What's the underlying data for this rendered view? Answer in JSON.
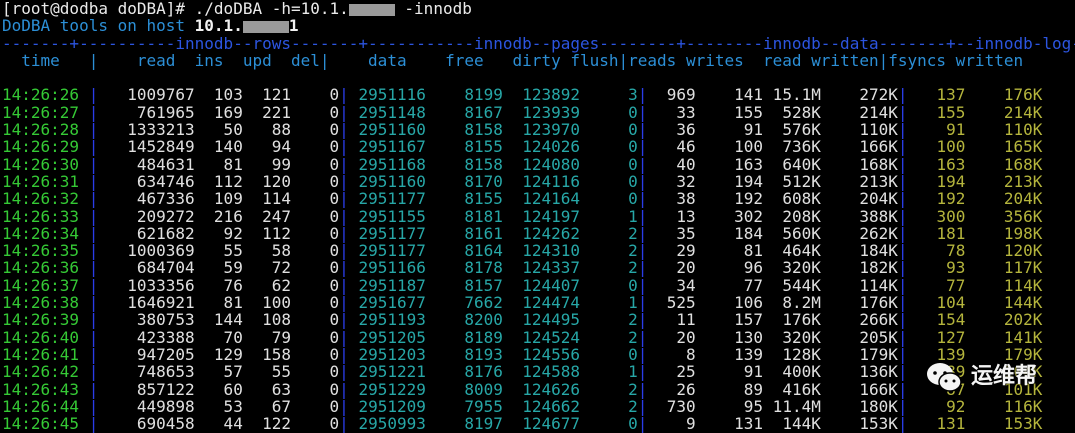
{
  "terminal": {
    "prompt": "[root@dodba doDBA]# ./doDBA -h=10.1.",
    "prompt_suffix": " -innodb",
    "banner": "DoDBA tools on host ",
    "host": "10.1.",
    "host_tail": "1",
    "group_line": "-------+----------innodb--rows-------+-----------innodb--pages--------+--------innodb--data-------+--innodb-log--",
    "header": {
      "time": "  time   |",
      "rows": "    read  ins  upd  del|",
      "pages": "    data    free   dirty flush|",
      "data": "reads writes  read written|",
      "log": "fsyncs written"
    },
    "columns": [
      "time",
      "read",
      "ins",
      "upd",
      "del",
      "data",
      "free",
      "dirty",
      "flush",
      "reads",
      "writes",
      "read",
      "written",
      "fsyncs",
      "written"
    ],
    "rows": [
      [
        "14:26:26",
        "1009767",
        "103",
        "121",
        "0",
        "2951116",
        "8199",
        "123892",
        "3",
        "969",
        "141",
        "15.1M",
        "272K",
        "137",
        "176K"
      ],
      [
        "14:26:27",
        "761965",
        "169",
        "221",
        "0",
        "2951148",
        "8167",
        "123939",
        "0",
        "33",
        "155",
        "528K",
        "214K",
        "155",
        "214K"
      ],
      [
        "14:26:28",
        "1333213",
        "50",
        "88",
        "0",
        "2951160",
        "8158",
        "123970",
        "0",
        "36",
        "91",
        "576K",
        "110K",
        "91",
        "110K"
      ],
      [
        "14:26:29",
        "1452849",
        "140",
        "94",
        "0",
        "2951167",
        "8155",
        "124026",
        "0",
        "46",
        "100",
        "736K",
        "166K",
        "100",
        "165K"
      ],
      [
        "14:26:30",
        "484631",
        "81",
        "99",
        "0",
        "2951168",
        "8158",
        "124080",
        "0",
        "40",
        "163",
        "640K",
        "168K",
        "163",
        "168K"
      ],
      [
        "14:26:31",
        "634746",
        "112",
        "120",
        "0",
        "2951160",
        "8170",
        "124116",
        "0",
        "32",
        "194",
        "512K",
        "213K",
        "194",
        "213K"
      ],
      [
        "14:26:32",
        "467336",
        "109",
        "114",
        "0",
        "2951177",
        "8155",
        "124164",
        "0",
        "38",
        "192",
        "608K",
        "204K",
        "192",
        "204K"
      ],
      [
        "14:26:33",
        "209272",
        "216",
        "247",
        "0",
        "2951155",
        "8181",
        "124197",
        "1",
        "13",
        "302",
        "208K",
        "388K",
        "300",
        "356K"
      ],
      [
        "14:26:34",
        "621682",
        "92",
        "112",
        "0",
        "2951177",
        "8161",
        "124262",
        "2",
        "35",
        "184",
        "560K",
        "262K",
        "181",
        "198K"
      ],
      [
        "14:26:35",
        "1000369",
        "55",
        "58",
        "0",
        "2951177",
        "8164",
        "124310",
        "2",
        "29",
        "81",
        "464K",
        "184K",
        "78",
        "120K"
      ],
      [
        "14:26:36",
        "684704",
        "59",
        "72",
        "0",
        "2951166",
        "8178",
        "124337",
        "2",
        "20",
        "96",
        "320K",
        "182K",
        "93",
        "117K"
      ],
      [
        "14:26:37",
        "1033356",
        "76",
        "62",
        "0",
        "2951187",
        "8157",
        "124407",
        "0",
        "34",
        "77",
        "544K",
        "114K",
        "77",
        "114K"
      ],
      [
        "14:26:38",
        "1646921",
        "81",
        "100",
        "0",
        "2951677",
        "7662",
        "124474",
        "1",
        "525",
        "106",
        "8.2M",
        "176K",
        "104",
        "144K"
      ],
      [
        "14:26:39",
        "380753",
        "144",
        "108",
        "0",
        "2951193",
        "8200",
        "124495",
        "2",
        "11",
        "157",
        "176K",
        "266K",
        "154",
        "202K"
      ],
      [
        "14:26:40",
        "423388",
        "70",
        "79",
        "0",
        "2951205",
        "8189",
        "124524",
        "2",
        "20",
        "130",
        "320K",
        "205K",
        "127",
        "141K"
      ],
      [
        "14:26:41",
        "947205",
        "129",
        "158",
        "0",
        "2951203",
        "8193",
        "124556",
        "0",
        "8",
        "139",
        "128K",
        "179K",
        "139",
        "179K"
      ],
      [
        "14:26:42",
        "748653",
        "57",
        "55",
        "0",
        "2951221",
        "8176",
        "124588",
        "1",
        "25",
        "91",
        "400K",
        "136K",
        "89",
        "104K"
      ],
      [
        "14:26:43",
        "857122",
        "60",
        "63",
        "0",
        "2951229",
        "8009",
        "124626",
        "2",
        "26",
        "89",
        "416K",
        "166K",
        "87",
        "101K"
      ],
      [
        "14:26:44",
        "449898",
        "53",
        "67",
        "0",
        "2951209",
        "7955",
        "124662",
        "2",
        "730",
        "95",
        "11.4M",
        "180K",
        "92",
        "116K"
      ],
      [
        "14:26:45",
        "690458",
        "44",
        "122",
        "0",
        "2950993",
        "8197",
        "124677",
        "0",
        "9",
        "131",
        "144K",
        "153K",
        "131",
        "153K"
      ]
    ]
  },
  "watermark": {
    "text": "运维帮",
    "icon": "wechat-icon"
  },
  "colors": {
    "time": "#35c935",
    "rows": "#e0e0e0",
    "pages": "#27a7a7",
    "data": "#e0e0e0",
    "log": "#b5b53d",
    "separator": "#2a3de8",
    "header": "#2c8fd6"
  }
}
